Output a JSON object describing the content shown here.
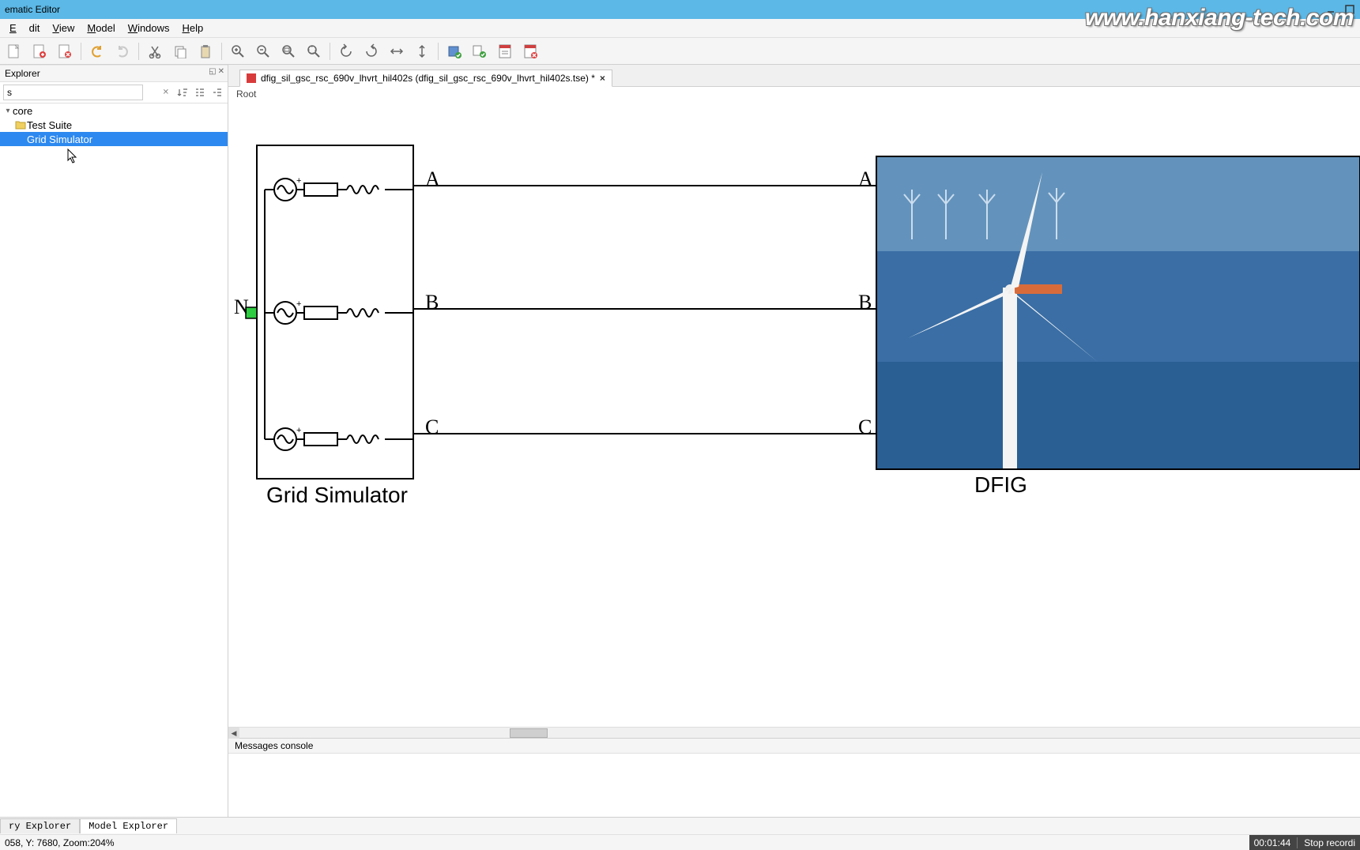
{
  "window": {
    "title": "ematic Editor"
  },
  "watermark": "www.hanxiang-tech.com",
  "menu": {
    "edit": "Edit",
    "view": "View",
    "model": "Model",
    "windows": "Windows",
    "help": "Help"
  },
  "explorer": {
    "title": "Explorer",
    "search_value": "s",
    "tree": {
      "root": "core",
      "child1": "Test Suite",
      "child2": "Grid Simulator"
    }
  },
  "tab": {
    "label": "dfig_sil_gsc_rsc_690v_lhvrt_hil402s (dfig_sil_gsc_rsc_690v_lhvrt_hil402s.tse) *"
  },
  "breadcrumb": "Root",
  "schematic": {
    "port_N": "N",
    "phase_A": "A",
    "phase_B": "B",
    "phase_C": "C",
    "grid_block": "Grid Simulator",
    "dfig_block": "DFIG"
  },
  "console": {
    "title": "Messages console"
  },
  "bottom_tabs": {
    "library": "ry Explorer",
    "model": "Model Explorer"
  },
  "status": {
    "coords": "058, Y:  7680, Zoom:204%",
    "timer": "00:01:44",
    "rec": "Stop recordi"
  }
}
